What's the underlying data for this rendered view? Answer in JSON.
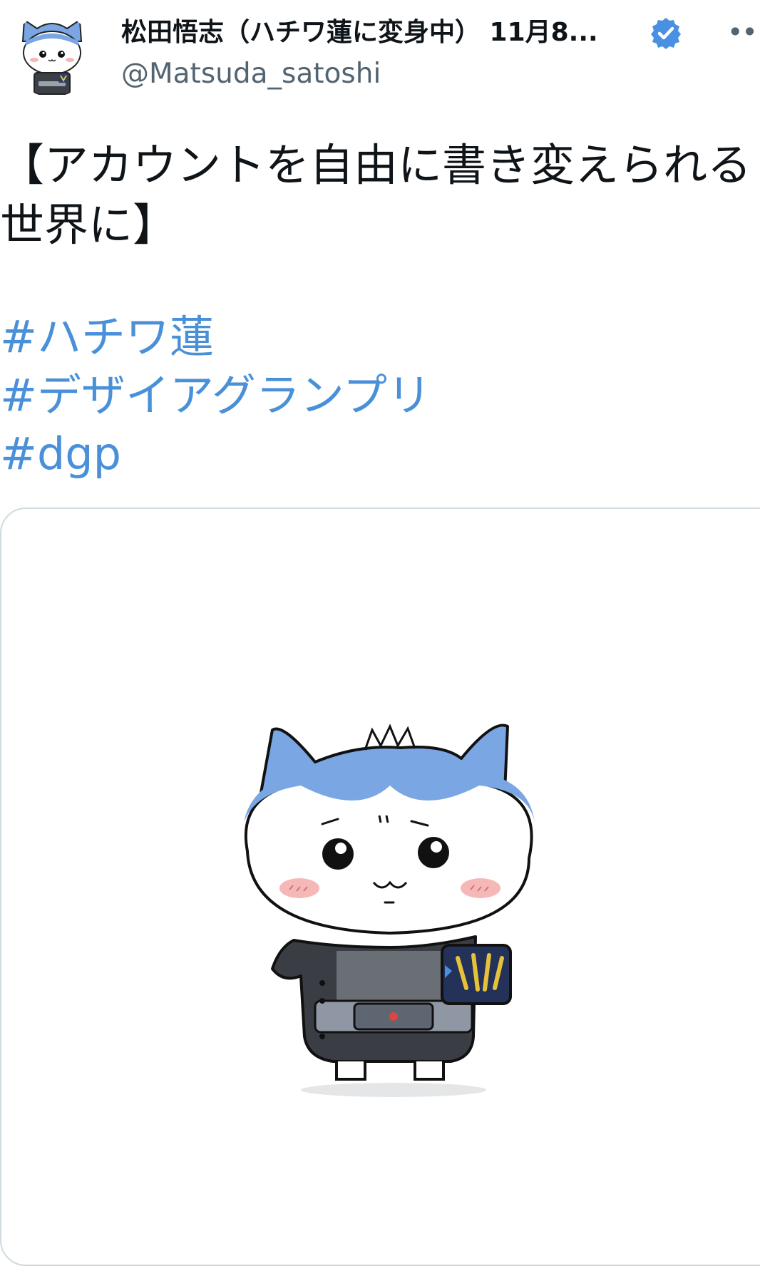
{
  "author": {
    "display_name": "松田悟志（ハチワ蓮に変身中） 11月8...",
    "handle": "@Matsuda_satoshi",
    "verified": true
  },
  "icons": {
    "avatar": "avatar-image",
    "verified": "verified-badge-icon",
    "more": "more-options-icon"
  },
  "more_label": "•••",
  "tweet": {
    "text": "【アカウントを自由に書き変えられる\n世界に】",
    "hashtags": [
      "#ハチワ蓮",
      "#デザイアグランプリ",
      "#dgp"
    ]
  },
  "colors": {
    "hashtag": "#4a90d9",
    "verified": "#4a90e2",
    "hair": "#7aa6e3"
  }
}
